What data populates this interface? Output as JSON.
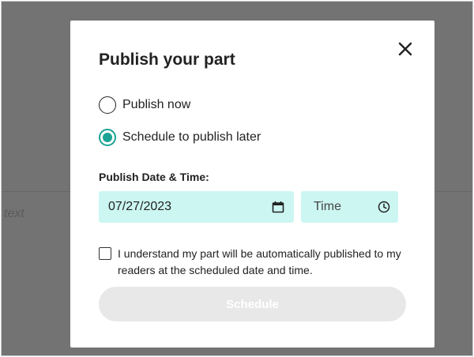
{
  "background": {
    "placeholder": "text"
  },
  "modal": {
    "title": "Publish your part",
    "close_icon": "close-icon",
    "options": [
      {
        "label": "Publish now",
        "checked": false
      },
      {
        "label": "Schedule to publish later",
        "checked": true
      }
    ],
    "datetime_label": "Publish Date & Time:",
    "date_value": "07/27/2023",
    "time_placeholder": "Time",
    "consent_text": "I understand my part will be automatically published to my readers at the scheduled date and time.",
    "schedule_label": "Schedule"
  },
  "colors": {
    "accent": "#1aa394",
    "field_bg": "#ccf6f2",
    "disabled_button": "#e8e8e8"
  }
}
